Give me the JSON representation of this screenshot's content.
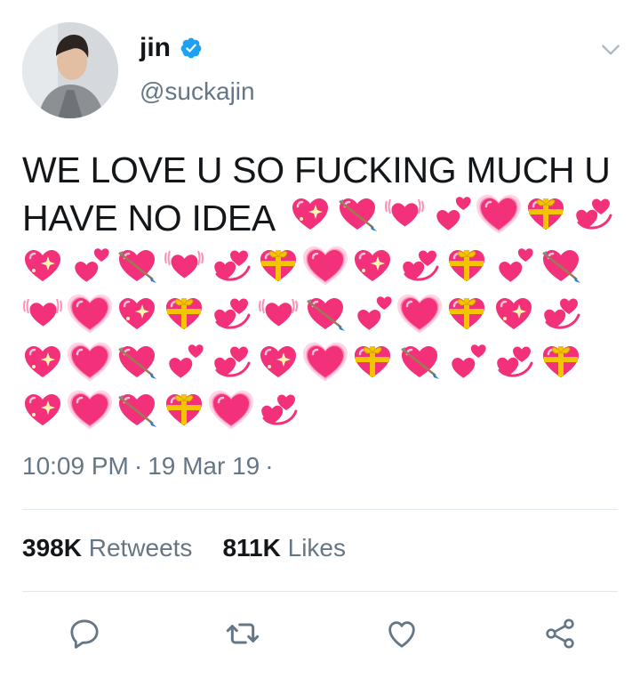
{
  "user": {
    "name": "jin",
    "handle": "@suckajin",
    "verified": true
  },
  "tweet": {
    "text": "WE LOVE U SO FUCKING MUCH U HAVE NO IDEA",
    "time": "10:09 PM",
    "date": "19 Mar 19",
    "separator": "·"
  },
  "emoji": {
    "line1": [
      "sparkle",
      "arrow",
      "beating",
      "two",
      "growing",
      "gift",
      "revolving"
    ],
    "rows": [
      [
        "sparkle",
        "two",
        "arrow",
        "beating",
        "revolving",
        "gift",
        "growing",
        "sparkle",
        "revolving",
        "gift",
        "two",
        "arrow"
      ],
      [
        "beating",
        "growing",
        "sparkle",
        "gift",
        "revolving",
        "beating",
        "arrow",
        "two",
        "growing",
        "gift",
        "sparkle",
        "revolving"
      ],
      [
        "sparkle",
        "growing",
        "arrow",
        "two",
        "revolving",
        "sparkle",
        "growing",
        "gift",
        "arrow",
        "two",
        "revolving",
        "gift"
      ],
      [
        "sparkle",
        "growing",
        "arrow",
        "gift",
        "growing",
        "revolving"
      ]
    ]
  },
  "stats": {
    "retweets_count": "398K",
    "retweets_label": "Retweets",
    "likes_count": "811K",
    "likes_label": "Likes"
  },
  "colors": {
    "heart": "#f2317a",
    "heart_light": "#ff8fb8",
    "heart_glow": "#ffd3e3",
    "gift_bow": "#f5c400",
    "arrow": "#2a7bd2",
    "verified": "#1da1f2",
    "secondary_text": "#657786",
    "icon": "#657786"
  }
}
